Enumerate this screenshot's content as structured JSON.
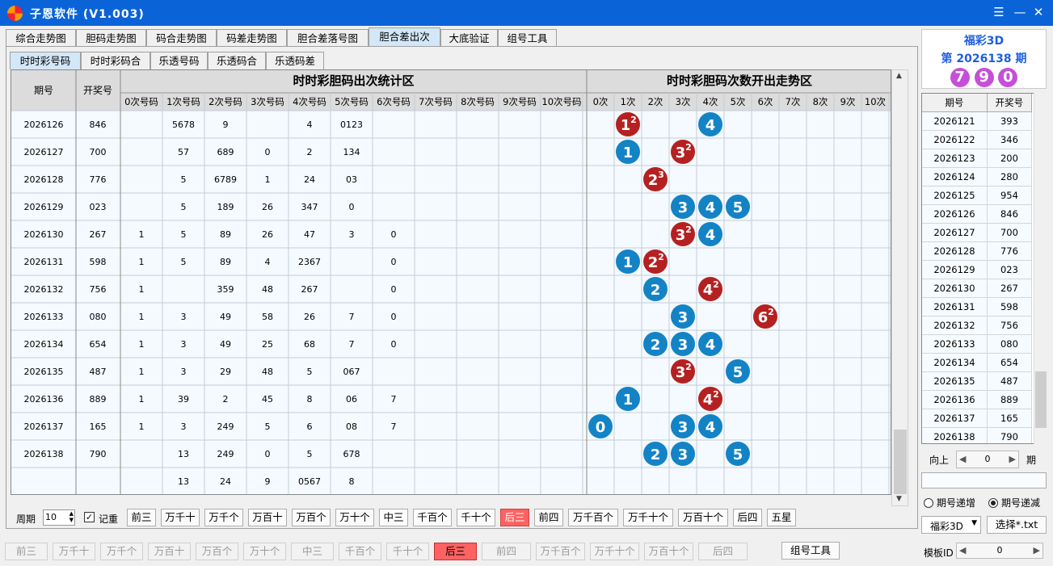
{
  "window": {
    "title": "子恩软件 (V1.003)",
    "controls": [
      "☰",
      "—",
      "✕"
    ]
  },
  "tabs": [
    "综合走势图",
    "胆码走势图",
    "码合走势图",
    "码差走势图",
    "胆合差落号图",
    "胆合差出次",
    "大底验证",
    "组号工具"
  ],
  "active_tab": "胆合差出次",
  "subtabs": [
    "时时彩号码",
    "时时彩码合",
    "乐透号码",
    "乐透码合",
    "乐透码差"
  ],
  "active_subtab": "时时彩号码",
  "grid": {
    "h_issue": "期号",
    "h_draw": "开奖号",
    "stat_title": "时时彩胆码出次统计区",
    "trend_title": "时时彩胆码次数开出走势区",
    "stat_cols": [
      "0次号码",
      "1次号码",
      "2次号码",
      "3次号码",
      "4次号码",
      "5次号码",
      "6次号码",
      "7次号码",
      "8次号码",
      "9次号码",
      "10次号码"
    ],
    "trend_cols": [
      "0次",
      "1次",
      "2次",
      "3次",
      "4次",
      "5次",
      "6次",
      "7次",
      "8次",
      "9次",
      "10次"
    ],
    "rows": [
      {
        "issue": "2026126",
        "draw": "846",
        "stats": [
          "",
          "5678",
          "9",
          "",
          "4",
          "0123",
          "",
          "",
          "",
          "",
          ""
        ],
        "balls": [
          {
            "c": 1,
            "n": "1",
            "sup": "2",
            "red": true
          },
          {
            "c": 4,
            "n": "4",
            "sup": "",
            "red": false
          }
        ]
      },
      {
        "issue": "2026127",
        "draw": "700",
        "stats": [
          "",
          "57",
          "689",
          "0",
          "2",
          "134",
          "",
          "",
          "",
          "",
          ""
        ],
        "balls": [
          {
            "c": 1,
            "n": "1",
            "sup": "",
            "red": false
          },
          {
            "c": 3,
            "n": "3",
            "sup": "2",
            "red": true
          }
        ]
      },
      {
        "issue": "2026128",
        "draw": "776",
        "stats": [
          "",
          "5",
          "6789",
          "1",
          "24",
          "03",
          "",
          "",
          "",
          "",
          ""
        ],
        "balls": [
          {
            "c": 2,
            "n": "2",
            "sup": "3",
            "red": true
          }
        ]
      },
      {
        "issue": "2026129",
        "draw": "023",
        "stats": [
          "",
          "5",
          "189",
          "26",
          "347",
          "0",
          "",
          "",
          "",
          "",
          ""
        ],
        "balls": [
          {
            "c": 3,
            "n": "3",
            "sup": "",
            "red": false
          },
          {
            "c": 4,
            "n": "4",
            "sup": "",
            "red": false
          },
          {
            "c": 5,
            "n": "5",
            "sup": "",
            "red": false
          }
        ]
      },
      {
        "issue": "2026130",
        "draw": "267",
        "stats": [
          "1",
          "5",
          "89",
          "26",
          "47",
          "3",
          "0",
          "",
          "",
          "",
          ""
        ],
        "balls": [
          {
            "c": 3,
            "n": "3",
            "sup": "2",
            "red": true
          },
          {
            "c": 4,
            "n": "4",
            "sup": "",
            "red": false
          }
        ]
      },
      {
        "issue": "2026131",
        "draw": "598",
        "stats": [
          "1",
          "5",
          "89",
          "4",
          "2367",
          "",
          "0",
          "",
          "",
          "",
          ""
        ],
        "balls": [
          {
            "c": 1,
            "n": "1",
            "sup": "",
            "red": false
          },
          {
            "c": 2,
            "n": "2",
            "sup": "2",
            "red": true
          }
        ]
      },
      {
        "issue": "2026132",
        "draw": "756",
        "stats": [
          "1",
          "",
          "359",
          "48",
          "267",
          "",
          "0",
          "",
          "",
          "",
          ""
        ],
        "balls": [
          {
            "c": 2,
            "n": "2",
            "sup": "",
            "red": false
          },
          {
            "c": 4,
            "n": "4",
            "sup": "2",
            "red": true
          }
        ]
      },
      {
        "issue": "2026133",
        "draw": "080",
        "stats": [
          "1",
          "3",
          "49",
          "58",
          "26",
          "7",
          "0",
          "",
          "",
          "",
          ""
        ],
        "balls": [
          {
            "c": 3,
            "n": "3",
            "sup": "",
            "red": false
          },
          {
            "c": 6,
            "n": "6",
            "sup": "2",
            "red": true
          }
        ]
      },
      {
        "issue": "2026134",
        "draw": "654",
        "stats": [
          "1",
          "3",
          "49",
          "25",
          "68",
          "7",
          "0",
          "",
          "",
          "",
          ""
        ],
        "balls": [
          {
            "c": 2,
            "n": "2",
            "sup": "",
            "red": false
          },
          {
            "c": 3,
            "n": "3",
            "sup": "",
            "red": false
          },
          {
            "c": 4,
            "n": "4",
            "sup": "",
            "red": false
          }
        ]
      },
      {
        "issue": "2026135",
        "draw": "487",
        "stats": [
          "1",
          "3",
          "29",
          "48",
          "5",
          "067",
          "",
          "",
          "",
          "",
          ""
        ],
        "balls": [
          {
            "c": 3,
            "n": "3",
            "sup": "2",
            "red": true
          },
          {
            "c": 5,
            "n": "5",
            "sup": "",
            "red": false
          }
        ]
      },
      {
        "issue": "2026136",
        "draw": "889",
        "stats": [
          "1",
          "39",
          "2",
          "45",
          "8",
          "06",
          "7",
          "",
          "",
          "",
          ""
        ],
        "balls": [
          {
            "c": 1,
            "n": "1",
            "sup": "",
            "red": false
          },
          {
            "c": 4,
            "n": "4",
            "sup": "2",
            "red": true
          }
        ]
      },
      {
        "issue": "2026137",
        "draw": "165",
        "stats": [
          "1",
          "3",
          "249",
          "5",
          "6",
          "08",
          "7",
          "",
          "",
          "",
          ""
        ],
        "balls": [
          {
            "c": 0,
            "n": "0",
            "sup": "",
            "red": false
          },
          {
            "c": 3,
            "n": "3",
            "sup": "",
            "red": false
          },
          {
            "c": 4,
            "n": "4",
            "sup": "",
            "red": false
          }
        ]
      },
      {
        "issue": "2026138",
        "draw": "790",
        "stats": [
          "",
          "13",
          "249",
          "0",
          "5",
          "678",
          "",
          "",
          "",
          "",
          ""
        ],
        "balls": [
          {
            "c": 2,
            "n": "2",
            "sup": "",
            "red": false
          },
          {
            "c": 3,
            "n": "3",
            "sup": "",
            "red": false
          },
          {
            "c": 5,
            "n": "5",
            "sup": "",
            "red": false
          }
        ]
      },
      {
        "issue": "",
        "draw": "",
        "stats": [
          "",
          "13",
          "24",
          "9",
          "0567",
          "8",
          "",
          "",
          "",
          "",
          ""
        ],
        "balls": []
      }
    ],
    "colors": {
      "blue": "#1483c6",
      "red": "#b52121",
      "header_bg": "#dcdcdc",
      "cell_bg": "#f4faff"
    }
  },
  "period": {
    "label": "周期",
    "value": "10",
    "record_label": "记重",
    "record_checked": true
  },
  "buttons1": [
    "前三",
    "万千十",
    "万千个",
    "万百十",
    "万百个",
    "万十个",
    "中三",
    "千百个",
    "千十个",
    "后三",
    "前四",
    "万千百个",
    "万千十个",
    "万百十个",
    "后四",
    "五星"
  ],
  "buttons1_active": "后三",
  "buttons2": [
    "前三",
    "万千十",
    "万千个",
    "万百十",
    "万百个",
    "万十个",
    "中三",
    "千百个",
    "千十个",
    "后三",
    "前四",
    "万千百个",
    "万千十个",
    "万百十个",
    "后四"
  ],
  "buttons2_active": "后三",
  "group_tool": "组号工具",
  "side": {
    "lottery": "福彩3D",
    "issue": "第 2026138 期",
    "balls": [
      "7",
      "9",
      "0"
    ],
    "ball_color": "#c64fd8"
  },
  "list": {
    "h_issue": "期号",
    "h_draw": "开奖号",
    "rows": [
      [
        "2026121",
        "393"
      ],
      [
        "2026122",
        "346"
      ],
      [
        "2026123",
        "200"
      ],
      [
        "2026124",
        "280"
      ],
      [
        "2026125",
        "954"
      ],
      [
        "2026126",
        "846"
      ],
      [
        "2026127",
        "700"
      ],
      [
        "2026128",
        "776"
      ],
      [
        "2026129",
        "023"
      ],
      [
        "2026130",
        "267"
      ],
      [
        "2026131",
        "598"
      ],
      [
        "2026132",
        "756"
      ],
      [
        "2026133",
        "080"
      ],
      [
        "2026134",
        "654"
      ],
      [
        "2026135",
        "487"
      ],
      [
        "2026136",
        "889"
      ],
      [
        "2026137",
        "165"
      ],
      [
        "2026138",
        "790"
      ]
    ]
  },
  "nav": {
    "up_label": "向上",
    "value": "0",
    "unit": "期"
  },
  "order": {
    "inc": "期号递增",
    "dec": "期号递减",
    "selected": "dec"
  },
  "select": {
    "value": "福彩3D",
    "file_button": "选择*.txt"
  },
  "template": {
    "label": "模板ID",
    "value": "0"
  }
}
